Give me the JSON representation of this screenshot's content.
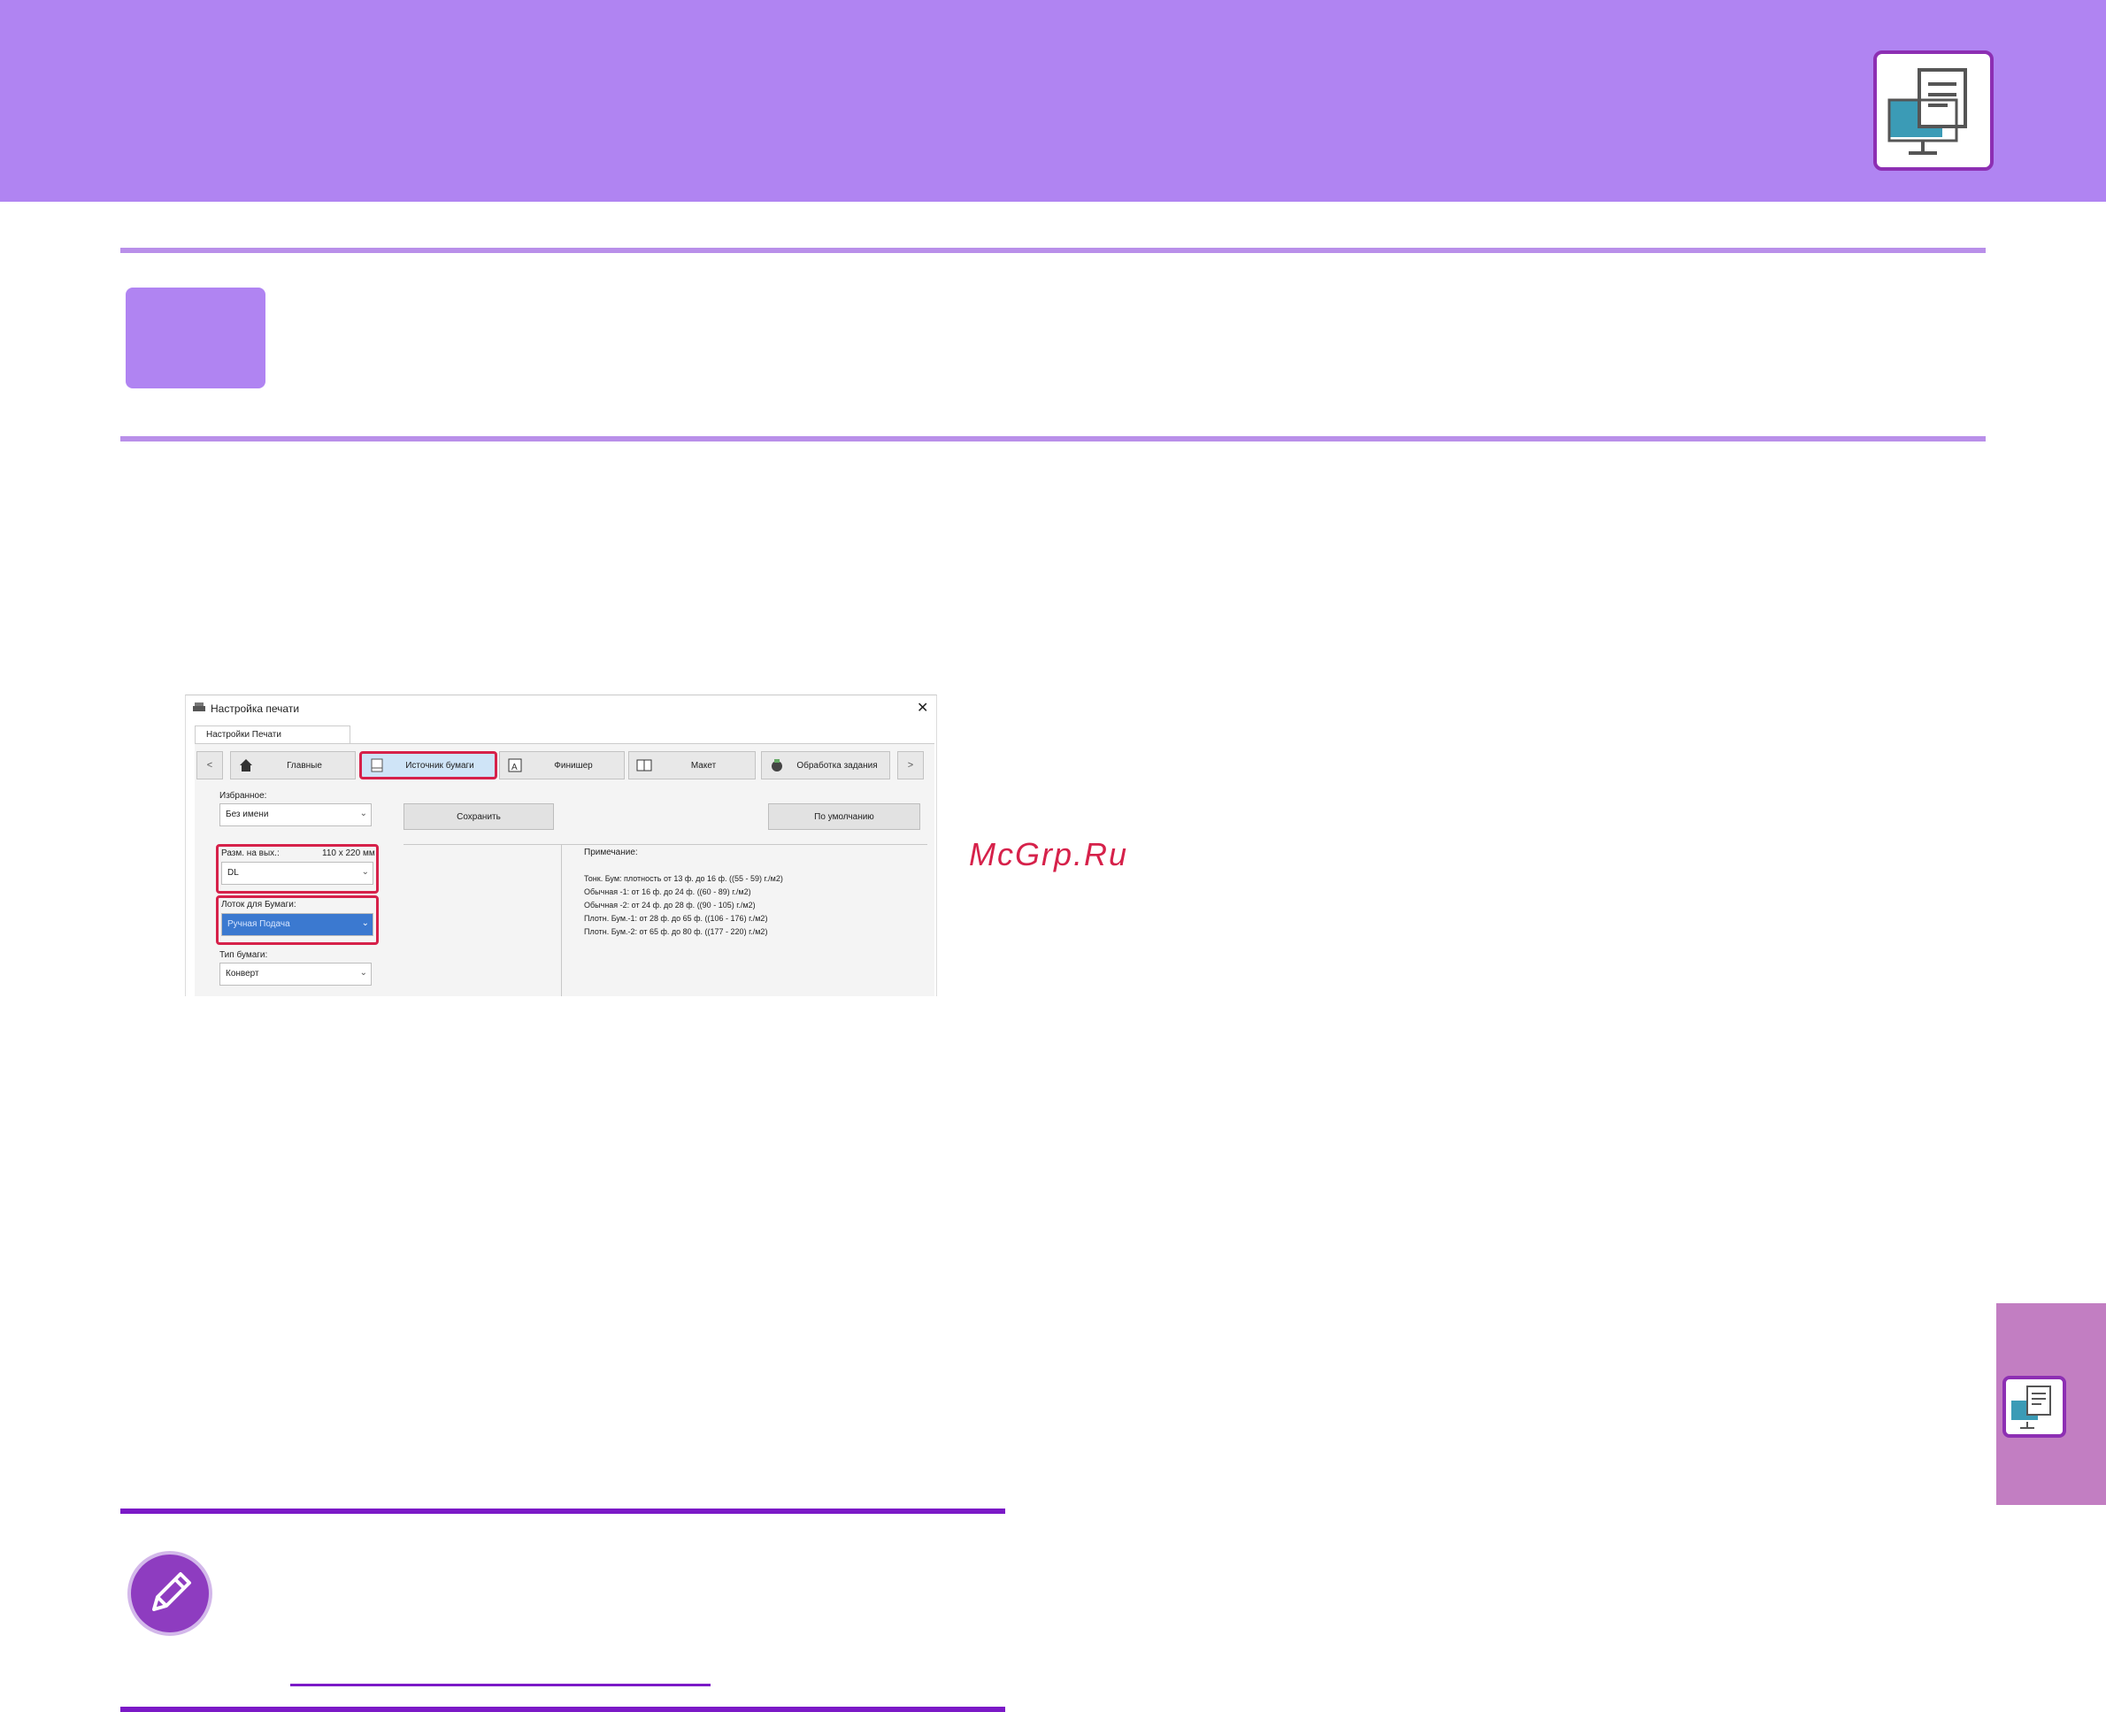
{
  "colors": {
    "header": "#b084f2",
    "accent": "#8d2fb3",
    "highlight": "#d6214a",
    "note": "#7b19c7"
  },
  "icons": {
    "header": "print-to-pc-icon",
    "side": "print-to-pc-icon",
    "note": "pencil-icon"
  },
  "watermark": "McGrp.Ru",
  "dialog": {
    "title": "Настройка печати",
    "close": "✕",
    "tab": "Настройки Печати",
    "nav": {
      "prev": "<",
      "next": ">",
      "main": "Главные",
      "paper_source": "Источник бумаги",
      "finisher": "Финишер",
      "layout": "Макет",
      "job": "Обработка задания"
    },
    "favorites_label": "Избранное:",
    "favorites_value": "Без имени",
    "save": "Сохранить",
    "default": "По умолчанию",
    "size_label": "Разм. на вых.:",
    "size_value": "110 x 220 мм",
    "size_select": "DL",
    "tray_label": "Лоток для Бумаги:",
    "tray_select": "Ручная Подача",
    "type_label": "Тип бумаги:",
    "type_select": "Конверт",
    "notes_label": "Примечание:",
    "notes": [
      "Тонк. Бум: плотность от 13 ф. до 16 ф. ((55 - 59) г./м2)",
      "Обычная -1: от 16 ф. до 24 ф. ((60 - 89) г./м2)",
      "Обычная -2: от 24 ф. до 28 ф. ((90 - 105) г./м2)",
      "Плотн. Бум.-1: от 28 ф. до 65 ф. ((106 - 176) г./м2)",
      "Плотн. Бум.-2: от 65 ф. до 80 ф. ((177 - 220) г./м2)"
    ]
  }
}
